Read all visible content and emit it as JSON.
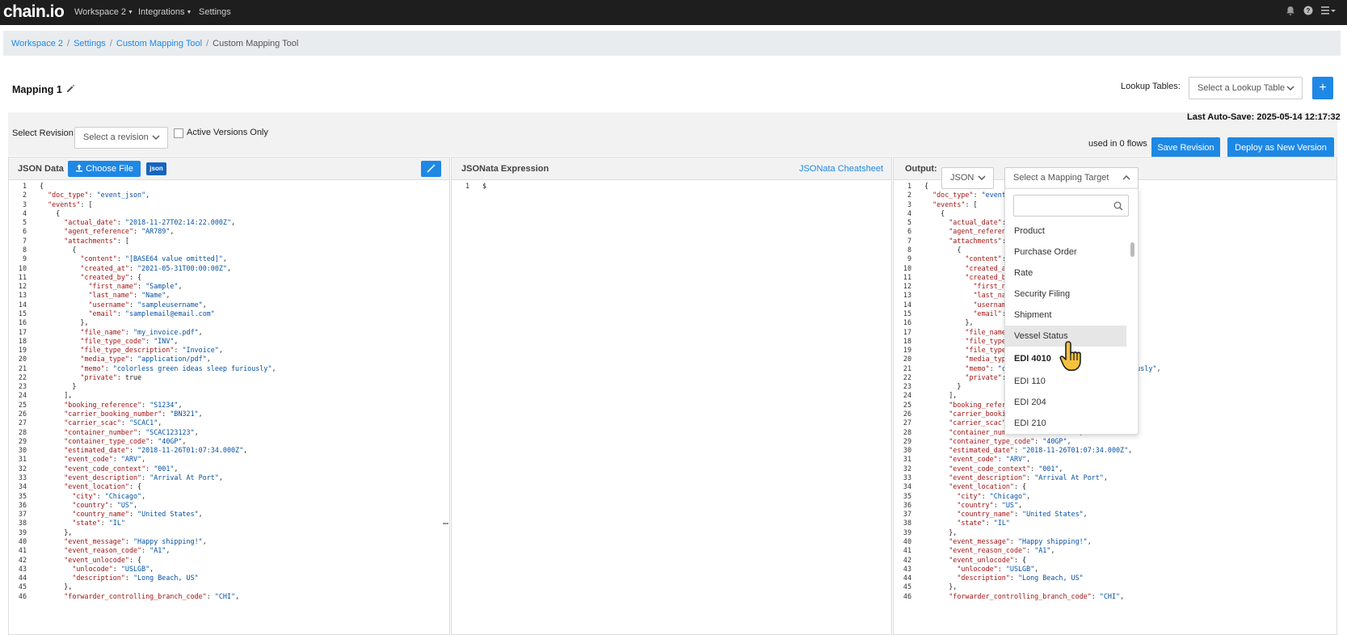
{
  "topbar": {
    "logo": "chain.io",
    "nav": [
      "Workspace 2",
      "Integrations",
      "Settings"
    ]
  },
  "breadcrumb": [
    "Workspace 2",
    "Settings",
    "Custom Mapping Tool",
    "Custom Mapping Tool"
  ],
  "mapping": {
    "title": "Mapping 1"
  },
  "lookup": {
    "label": "Lookup Tables:",
    "placeholder": "Select a Lookup Table",
    "add": "+"
  },
  "revision": {
    "label": "Select Revision",
    "placeholder": "Select a revision",
    "active_only": "Active Versions Only",
    "last_autosave": "Last Auto-Save: 2025-05-14 12:17:32",
    "used_in": "used in 0 flows",
    "save": "Save Revision",
    "deploy": "Deploy as New Version"
  },
  "json_panel": {
    "title": "JSON Data",
    "choose_file": "Choose File",
    "badge": "json"
  },
  "jsonata_panel": {
    "title": "JSONata Expression",
    "cheatsheet": "JSONata Cheatsheet",
    "code": "$"
  },
  "output_panel": {
    "title": "Output:",
    "format": "JSON",
    "target_placeholder": "Select a Mapping Target"
  },
  "dropdown": {
    "items": [
      "Product",
      "Purchase Order",
      "Rate",
      "Security Filing",
      "Shipment",
      "Vessel Status",
      "EDI 4010",
      "EDI 110",
      "EDI 204",
      "EDI 210"
    ],
    "highlighted": "Vessel Status",
    "group_header": "EDI 4010"
  },
  "code_lines": [
    "{",
    "  \"doc_type\": \"event_json\",",
    "  \"events\": [",
    "    {",
    "      \"actual_date\": \"2018-11-27T02:14:22.000Z\",",
    "      \"agent_reference\": \"AR789\",",
    "      \"attachments\": [",
    "        {",
    "          \"content\": \"[BASE64 value omitted]\",",
    "          \"created_at\": \"2021-05-31T00:00:00Z\",",
    "          \"created_by\": {",
    "            \"first_name\": \"Sample\",",
    "            \"last_name\": \"Name\",",
    "            \"username\": \"sampleusername\",",
    "            \"email\": \"samplemail@email.com\"",
    "          },",
    "          \"file_name\": \"my_invoice.pdf\",",
    "          \"file_type_code\": \"INV\",",
    "          \"file_type_description\": \"Invoice\",",
    "          \"media_type\": \"application/pdf\",",
    "          \"memo\": \"colorless green ideas sleep furiously\",",
    "          \"private\": true",
    "        }",
    "      ],",
    "      \"booking_reference\": \"S1234\",",
    "      \"carrier_booking_number\": \"BN321\",",
    "      \"carrier_scac\": \"SCAC1\",",
    "      \"container_number\": \"SCAC123123\",",
    "      \"container_type_code\": \"40GP\",",
    "      \"estimated_date\": \"2018-11-26T01:07:34.000Z\",",
    "      \"event_code\": \"ARV\",",
    "      \"event_code_context\": \"001\",",
    "      \"event_description\": \"Arrival At Port\",",
    "      \"event_location\": {",
    "        \"city\": \"Chicago\",",
    "        \"country\": \"US\",",
    "        \"country_name\": \"United States\",",
    "        \"state\": \"IL\"",
    "      },",
    "      \"event_message\": \"Happy shipping!\",",
    "      \"event_reason_code\": \"A1\",",
    "      \"event_unlocode\": {",
    "        \"unlocode\": \"USLGB\",",
    "        \"description\": \"Long Beach, US\"",
    "      },",
    "      \"forwarder_controlling_branch_code\": \"CHI\","
  ]
}
